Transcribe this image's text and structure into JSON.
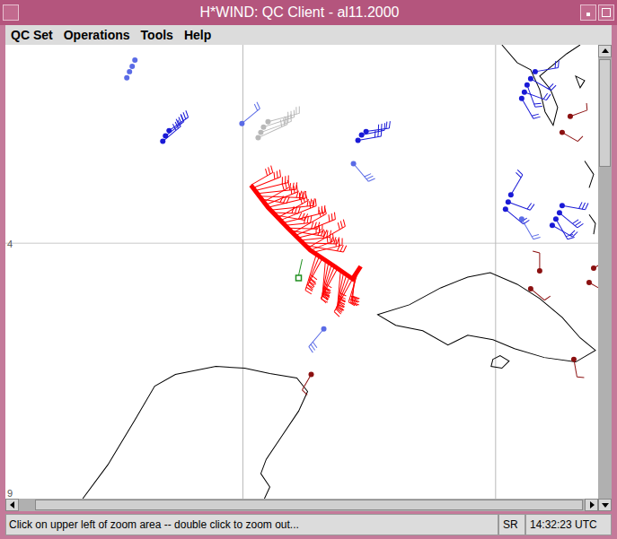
{
  "window": {
    "title": "H*WIND: QC Client - al11.2000"
  },
  "menu": [
    {
      "label": "QC Set"
    },
    {
      "label": "Operations"
    },
    {
      "label": "Tools"
    },
    {
      "label": "Help"
    }
  ],
  "map": {
    "grid_labels": [
      "4",
      "9"
    ],
    "observation_sets": [
      {
        "kind": "recon",
        "color": "#ff0000"
      },
      {
        "kind": "ship",
        "color": "#1a1ad6"
      },
      {
        "kind": "buoy",
        "color": "#5a6be6"
      },
      {
        "kind": "satellite",
        "color": "#b8b8b8"
      },
      {
        "kind": "land",
        "color": "#8b1010"
      },
      {
        "kind": "marker",
        "color": "#1f8f1f"
      }
    ]
  },
  "status_bar": {
    "message": "Click on upper left of zoom area -- double click to zoom out...",
    "mode": "SR",
    "time": "14:32:23 UTC"
  }
}
